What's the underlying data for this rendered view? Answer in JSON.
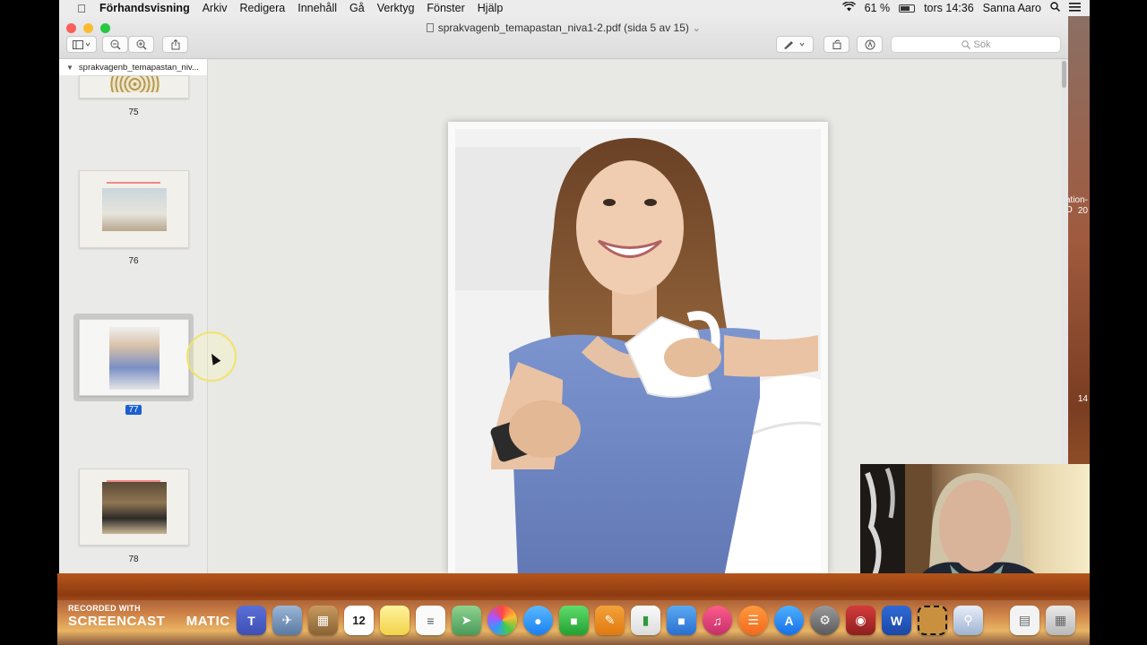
{
  "menubar": {
    "items": [
      "Förhandsvisning",
      "Arkiv",
      "Redigera",
      "Innehåll",
      "Gå",
      "Verktyg",
      "Fönster",
      "Hjälp"
    ],
    "battery": "61 %",
    "clock": "tors 14:36",
    "user": "Sanna Aaro"
  },
  "window": {
    "title": "sprakvagenb_temapastan_niva1-2.pdf (sida 5 av 15)",
    "search_placeholder": "Sök"
  },
  "sidebar": {
    "header": "sprakvagenb_temapastan_niv...",
    "pages": [
      {
        "number": "75",
        "selected": false
      },
      {
        "number": "76",
        "selected": false
      },
      {
        "number": "77",
        "selected": true
      },
      {
        "number": "78",
        "selected": false
      }
    ]
  },
  "desktop_labels": [
    "ation-O",
    "20",
    "14"
  ],
  "recorder": {
    "line1": "RECORDED WITH",
    "line2": "SCREENCAST",
    "line3": "MATIC"
  },
  "dock": {
    "calendar_day": "12",
    "word_letter": "W",
    "teams_letter": "T"
  },
  "colors": {
    "selection_blue": "#1a5fd0",
    "menubar_bg": "#ececec",
    "viewer_bg": "#e8e8e4"
  }
}
